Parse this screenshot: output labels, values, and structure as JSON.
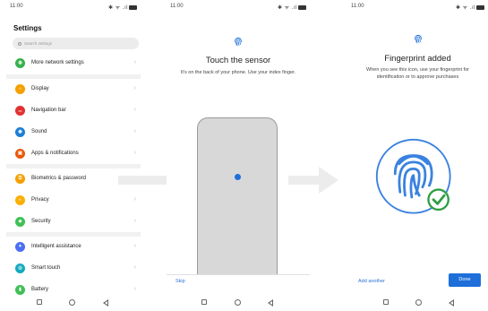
{
  "screens": [
    {
      "status": {
        "time": "11:00",
        "signal": "✱ ᯤ .ıl",
        "battery_icon": "battery-icon"
      },
      "title": "Settings",
      "search": {
        "placeholder": "Search settings"
      },
      "items": [
        {
          "label": "More network settings",
          "color": "#37b24d",
          "icon": "globe-icon"
        },
        {
          "label": "Display",
          "color": "#f59f00",
          "icon": "brightness-icon"
        },
        {
          "label": "Navigation bar",
          "color": "#e03131",
          "icon": "nav-icon"
        },
        {
          "label": "Sound",
          "color": "#1c7ed6",
          "icon": "speaker-icon"
        },
        {
          "label": "Apps & notifications",
          "color": "#e8590c",
          "icon": "apps-icon"
        },
        {
          "label": "Biometrics & password",
          "color": "#f59f00",
          "icon": "key-icon"
        },
        {
          "label": "Privacy",
          "color": "#fab005",
          "icon": "privacy-icon"
        },
        {
          "label": "Security",
          "color": "#40c057",
          "icon": "shield-icon"
        },
        {
          "label": "Intelligent assistance",
          "color": "#4c6ef5",
          "icon": "assistant-icon"
        },
        {
          "label": "Smart touch",
          "color": "#15aabf",
          "icon": "touch-icon"
        },
        {
          "label": "Battery",
          "color": "#40c057",
          "icon": "battery-icon"
        }
      ]
    },
    {
      "status": {
        "time": "11:00",
        "signal": "✱ ᯤ .ıl"
      },
      "title": "Touch the sensor",
      "subtitle": "It's on the back of your phone. Use your index finger.",
      "skip_label": "Skip"
    },
    {
      "status": {
        "time": "11:00",
        "signal": "✱ ᯤ .ıl"
      },
      "title": "Fingerprint added",
      "subtitle": "When you see this icon, use your fingerprint for identification or to approve purchases",
      "add_another_label": "Add another",
      "done_label": "Done"
    }
  ],
  "colors": {
    "accent": "#1e6fd9",
    "success": "#2f9e44"
  }
}
